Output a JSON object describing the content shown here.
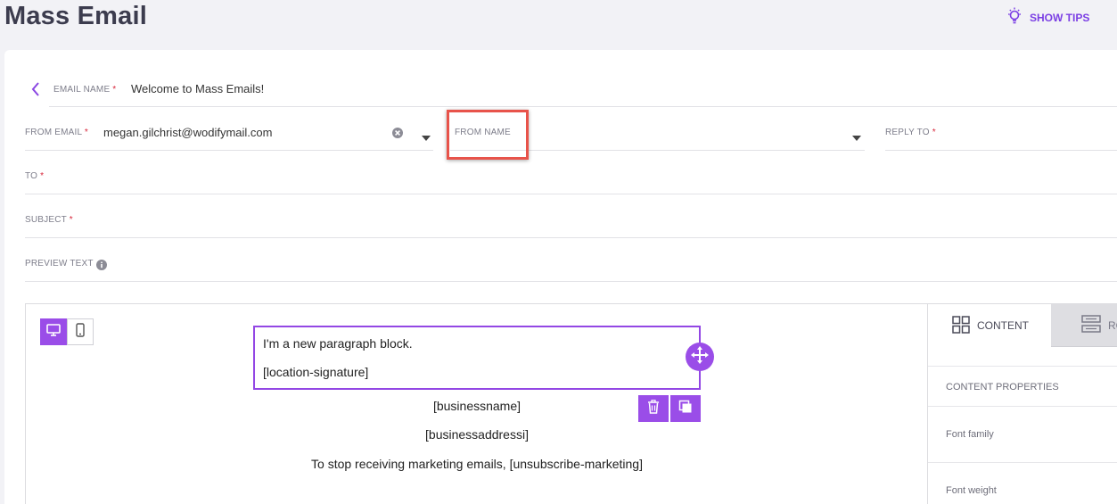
{
  "page": {
    "title": "Mass Email",
    "show_tips": "SHOW TIPS"
  },
  "form": {
    "email_name": {
      "label": "EMAIL NAME",
      "value": "Welcome to Mass Emails!"
    },
    "from_email": {
      "label": "FROM EMAIL",
      "value": "megan.gilchrist@wodifymail.com"
    },
    "from_name": {
      "label": "FROM NAME",
      "value": ""
    },
    "reply_to": {
      "label": "REPLY TO",
      "value": ""
    },
    "to": {
      "label": "TO",
      "value": ""
    },
    "subject": {
      "label": "SUBJECT",
      "value": ""
    },
    "preview_text": {
      "label": "PREVIEW TEXT",
      "value": ""
    },
    "required_mark": "*"
  },
  "editor": {
    "paragraph": {
      "line1": "I'm a new paragraph block.",
      "line2": "[location-signature]"
    },
    "footer": {
      "business_name": "[businessname]",
      "business_address": "[businessaddressi]",
      "unsubscribe": "To stop receiving marketing emails, [unsubscribe-marketing]"
    },
    "device_active": "desktop"
  },
  "panel": {
    "tab_content": "CONTENT",
    "tab_rows": "RO",
    "section_title": "CONTENT PROPERTIES",
    "font_family_label": "Font family",
    "font_weight_label": "Font weight"
  },
  "colors": {
    "accent": "#9a4de8",
    "highlight": "#e8534a",
    "required": "#d8283c"
  },
  "icons": [
    "lightbulb-icon",
    "chevron-left-icon",
    "clear-icon",
    "caret-down-icon",
    "info-icon",
    "desktop-icon",
    "mobile-icon",
    "move-icon",
    "trash-icon",
    "duplicate-icon",
    "grid-icon",
    "rows-icon"
  ]
}
